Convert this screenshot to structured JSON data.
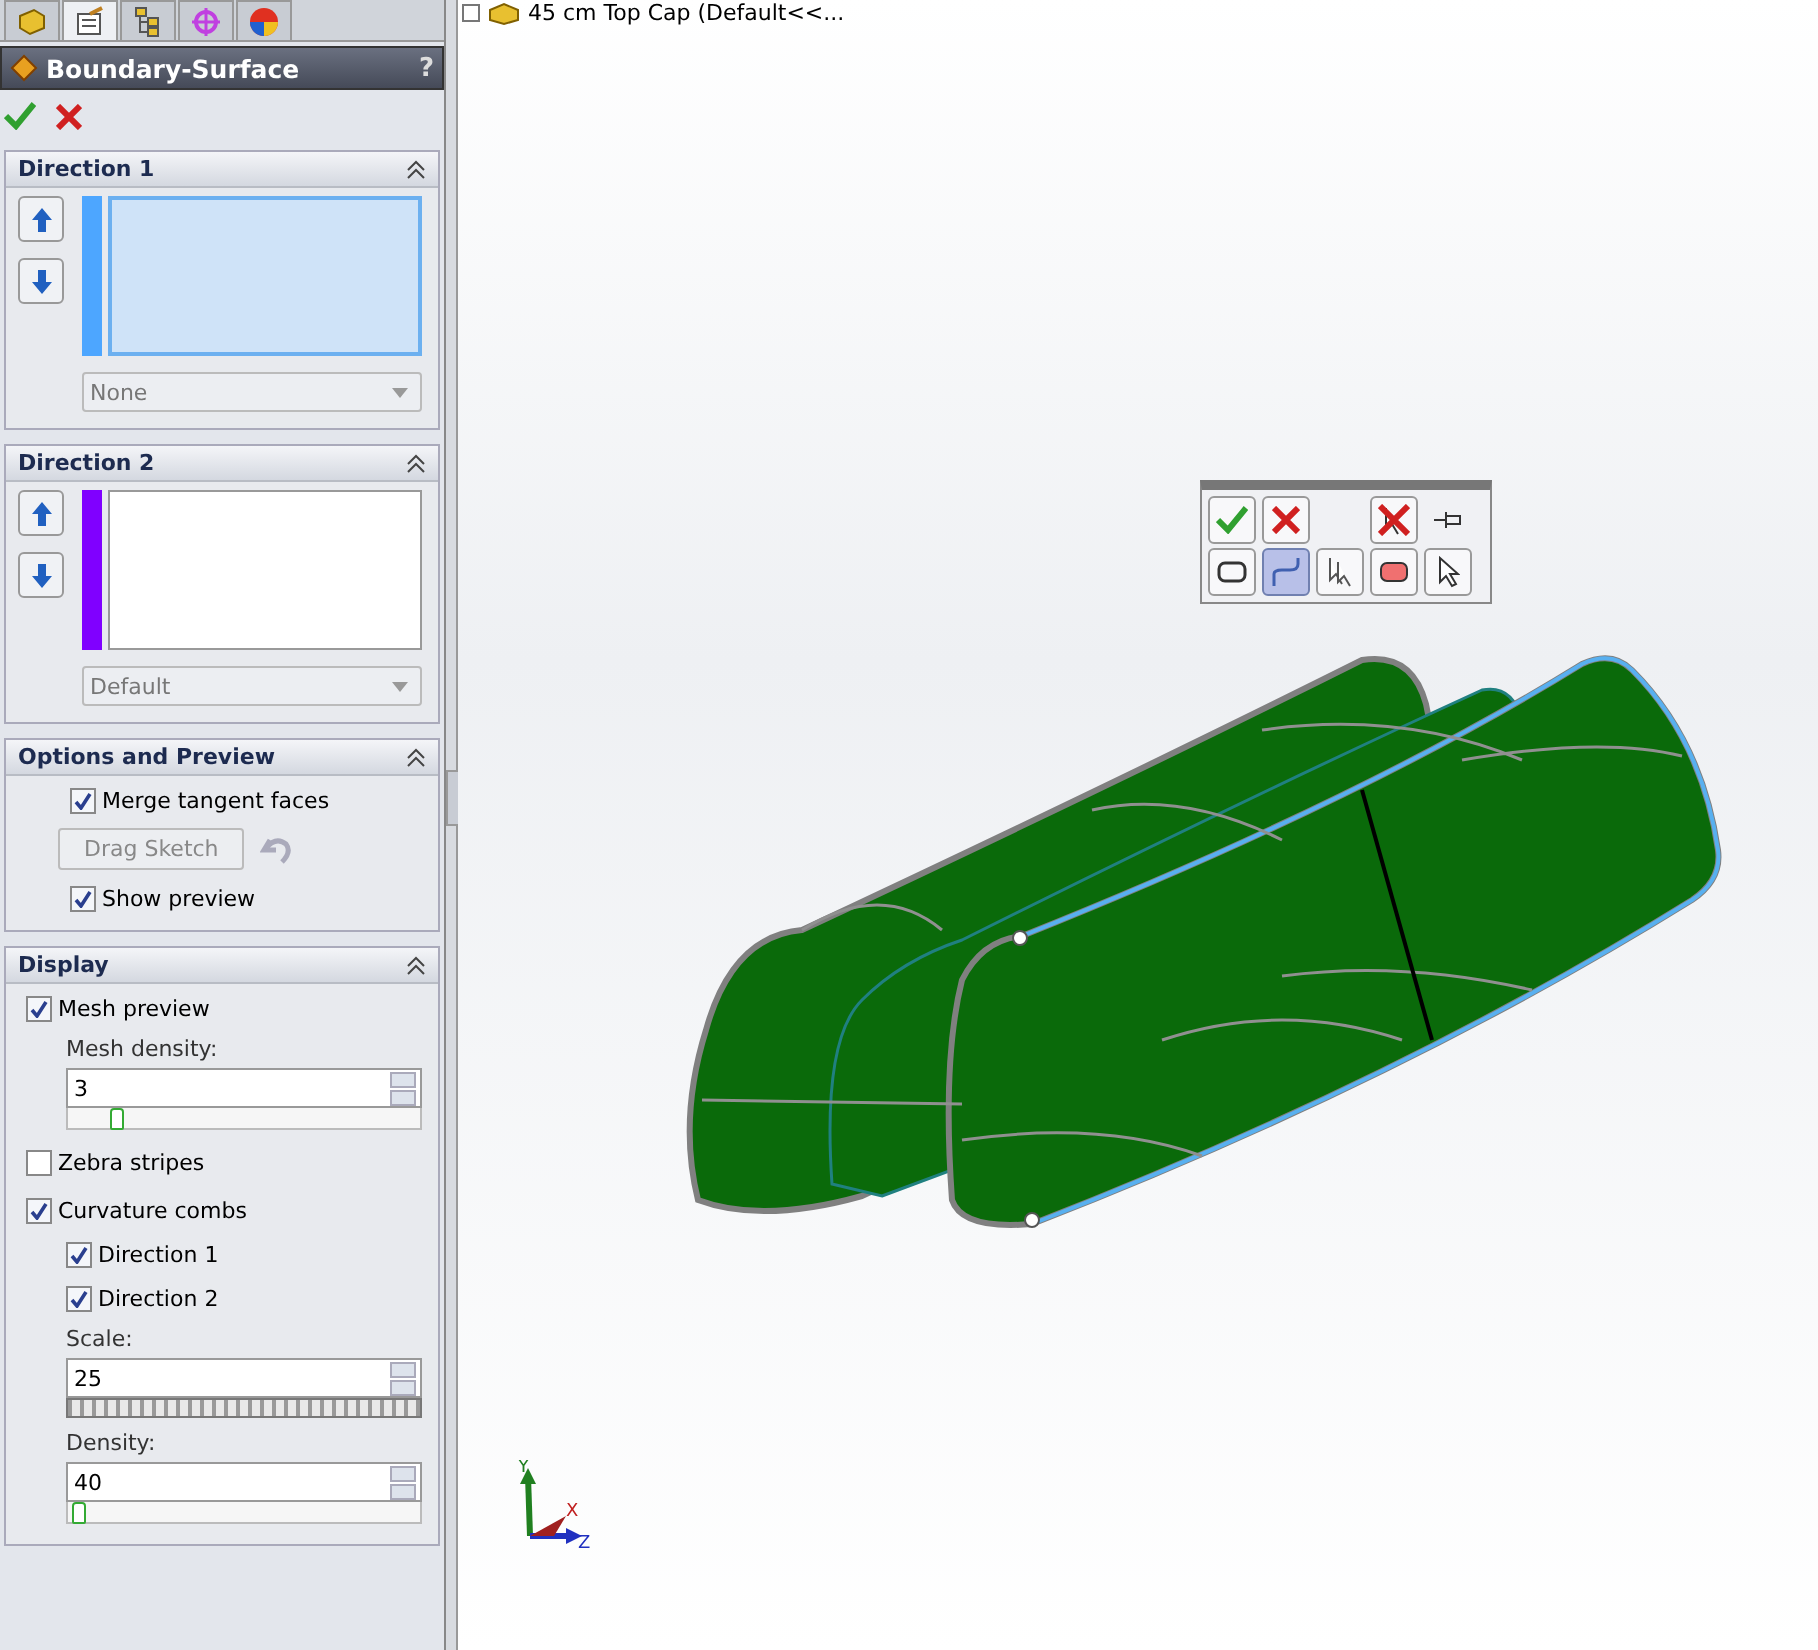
{
  "tabs": [
    {
      "kind": "feature-tree",
      "selected": false
    },
    {
      "kind": "property",
      "selected": true
    },
    {
      "kind": "configuration",
      "selected": false
    },
    {
      "kind": "target",
      "selected": false
    },
    {
      "kind": "appearance",
      "selected": false
    }
  ],
  "panel": {
    "title": "Boundary-Surface",
    "help": "?"
  },
  "directions": [
    {
      "title": "Direction 1",
      "expanded": true,
      "color": "#4da6ff",
      "active": true,
      "dropdown": "None"
    },
    {
      "title": "Direction 2",
      "expanded": true,
      "color": "#8000ff",
      "active": false,
      "dropdown": "Default"
    }
  ],
  "options": {
    "title": "Options and Preview",
    "expanded": true,
    "items": [
      {
        "kind": "checkbox",
        "label": "Merge tangent faces",
        "checked": true
      },
      {
        "kind": "button",
        "label": "Drag Sketch",
        "disabled": true
      },
      {
        "kind": "checkbox",
        "label": "Show preview",
        "checked": true
      }
    ]
  },
  "display": {
    "title": "Display",
    "expanded": true,
    "items": [
      {
        "kind": "checkbox",
        "label": "Mesh preview",
        "checked": true,
        "children": [
          {
            "kind": "label",
            "label": "Mesh density:"
          },
          {
            "kind": "spin-slider",
            "value": "3",
            "level": 0.12
          }
        ]
      },
      {
        "kind": "checkbox",
        "label": "Zebra stripes",
        "checked": false
      },
      {
        "kind": "checkbox",
        "label": "Curvature combs",
        "checked": true,
        "children": [
          {
            "kind": "checkbox",
            "label": "Direction 1",
            "checked": true
          },
          {
            "kind": "checkbox",
            "label": "Direction 2",
            "checked": true
          },
          {
            "kind": "label",
            "label": "Scale:"
          },
          {
            "kind": "spin-wheel",
            "value": "25"
          },
          {
            "kind": "label",
            "label": "Density:"
          },
          {
            "kind": "spin-slider",
            "value": "40",
            "level": 0.01
          }
        ]
      }
    ]
  },
  "tree_item": {
    "label": "45 cm Top Cap  (Default<<..."
  },
  "toolbar": [
    {
      "kind": "ok",
      "selected": false
    },
    {
      "kind": "cancel",
      "selected": false
    },
    {
      "kind": "cancel-select",
      "selected": false
    },
    {
      "kind": "pin",
      "selected": false
    },
    {
      "kind": "rounded-rect",
      "selected": false
    },
    {
      "kind": "curve",
      "selected": true
    },
    {
      "kind": "multi-arrow",
      "selected": false
    },
    {
      "kind": "filled-rect",
      "selected": false
    },
    {
      "kind": "arrow",
      "selected": false
    }
  ],
  "triad": {
    "x": "X",
    "y": "Y",
    "z": "Z"
  }
}
